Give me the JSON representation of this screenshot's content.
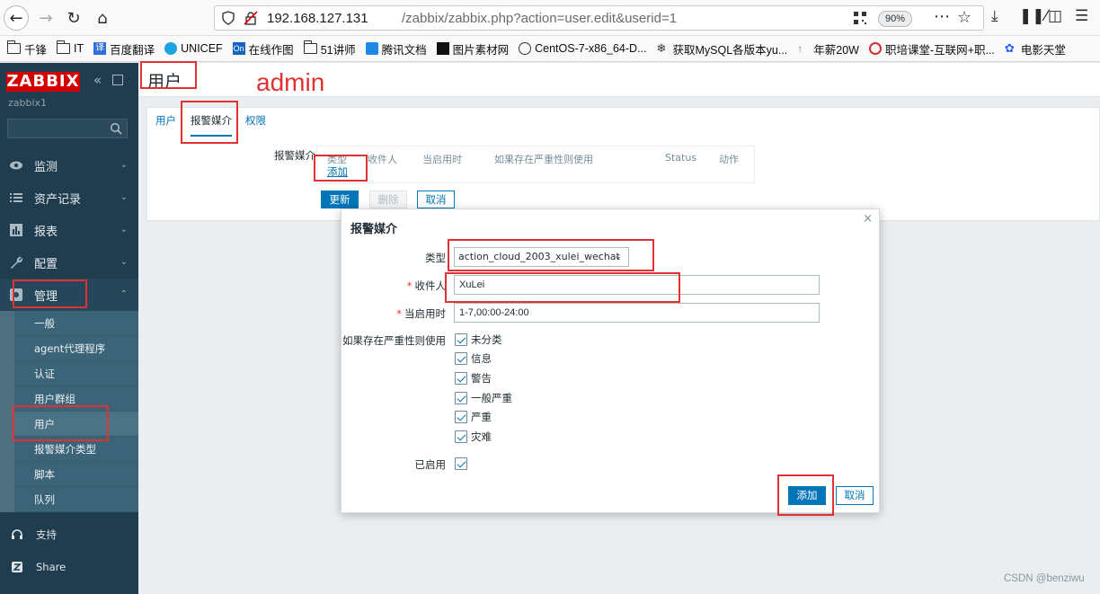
{
  "browser": {
    "url_host": "192.168.127.131",
    "url_path": "/zabbix/zabbix.php?action=user.edit&userid=1",
    "zoom": "90%",
    "bookmarks": [
      "千锋",
      "IT",
      "百度翻译",
      "UNICEF",
      "在线作图",
      "51讲师",
      "腾讯文档",
      "图片素材网",
      "CentOS-7-x86_64-D...",
      "获取MySQL各版本yu...",
      "年薪20W",
      "职培课堂-互联网+职...",
      "电影天堂"
    ]
  },
  "sidebar": {
    "logo": "ZABBIX",
    "server_name": "zabbix1",
    "menu": [
      {
        "label": "监测",
        "icon": "eye-icon"
      },
      {
        "label": "资产记录",
        "icon": "list-icon"
      },
      {
        "label": "报表",
        "icon": "bar-chart-icon"
      },
      {
        "label": "配置",
        "icon": "wrench-icon"
      },
      {
        "label": "管理",
        "icon": "gear-icon"
      }
    ],
    "submenu": [
      "一般",
      "agent代理程序",
      "认证",
      "用户群组",
      "用户",
      "报警媒介类型",
      "脚本",
      "队列"
    ],
    "support": "支持",
    "share": "Share"
  },
  "page": {
    "title": "用户",
    "tabs": [
      "用户",
      "报警媒介",
      "权限"
    ],
    "media_label": "报警媒介",
    "media_headers": [
      "类型",
      "收件人",
      "当启用时",
      "如果存在严重性则使用",
      "Status",
      "动作"
    ],
    "add_link": "添加",
    "buttons": {
      "update": "更新",
      "delete": "删除",
      "cancel": "取消"
    }
  },
  "modal": {
    "title": "报警媒介",
    "close": "×",
    "type_label": "类型",
    "type_value": "action_cloud_2003_xulei_wechat",
    "sendto_label": "收件人",
    "sendto_value": "XuLei",
    "when_label": "当启用时",
    "when_value": "1-7,00:00-24:00",
    "severity_label": "如果存在严重性则使用",
    "severities": [
      "未分类",
      "信息",
      "警告",
      "一般严重",
      "严重",
      "灾难"
    ],
    "enabled_label": "已启用",
    "add_button": "添加",
    "cancel_button": "取消"
  },
  "annotation": {
    "text": "admin",
    "color": "#e03232"
  },
  "watermark": "CSDN @benziwu"
}
